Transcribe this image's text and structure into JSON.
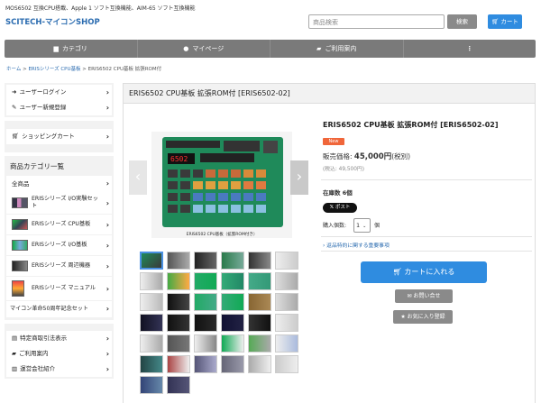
{
  "header": {
    "tagline": "MOS6502 互換CPU搭載、Apple 1 ソフト互換機能、AIM-65 ソフト互換機能",
    "shop_name": "SCITECH-マイコンSHOP",
    "search_placeholder": "商品検索",
    "search_button": "検索",
    "cart_button": "カート"
  },
  "nav": {
    "items": [
      {
        "label": "カテゴリ",
        "icon": "folder-icon"
      },
      {
        "label": "マイページ",
        "icon": "user-icon"
      },
      {
        "label": "ご利用案内",
        "icon": "map-icon"
      },
      {
        "label": "",
        "icon": "more-vertical-icon"
      }
    ]
  },
  "breadcrumb": {
    "home": "ホーム",
    "sep": ">",
    "category": "ERISシリーズ CPU基板",
    "current": "ERIS6502 CPU基板 拡張ROM付"
  },
  "sidebar": {
    "account": [
      {
        "label": "ユーザーログイン",
        "icon": "login-icon"
      },
      {
        "label": "ユーザー新規登録",
        "icon": "pencil-icon"
      }
    ],
    "cart_link": {
      "label": "ショッピングカート",
      "icon": "cart-icon"
    },
    "categories_title": "商品カテゴリ一覧",
    "categories": [
      {
        "label": "全商品"
      },
      {
        "label": "ERISシリーズ I/O実験セット"
      },
      {
        "label": "ERISシリーズ CPU基板"
      },
      {
        "label": "ERISシリーズ I/O基板"
      },
      {
        "label": "ERISシリーズ 周辺機器"
      },
      {
        "label": "ERISシリーズ マニュアル"
      },
      {
        "label": "マイコン革命50周年記念セット"
      }
    ],
    "info_links": [
      {
        "label": "特定商取引法表示",
        "icon": "document-icon"
      },
      {
        "label": "ご利用案内",
        "icon": "book-icon"
      },
      {
        "label": "運営会社紹介",
        "icon": "building-icon"
      }
    ]
  },
  "product": {
    "heading": "ERIS6502 CPU基板 拡張ROM付 [ERIS6502-02]",
    "title": "ERIS6502 CPU基板 拡張ROM付 [ERIS6502-02]",
    "badge": "New",
    "price_label": "販売価格:",
    "price_value": "45,000円",
    "price_tax": "(税別)",
    "price_taxin": "(税込: 49,500円)",
    "stock": "在庫数 6個",
    "x_post": "ポスト",
    "qty_label": "購入個数:",
    "qty_value": "1",
    "qty_unit": "個",
    "note_link": "返品特約に関する重要事項",
    "add_to_cart": "カートに入れる",
    "contact": "お問い合せ",
    "favorite": "お気に入り登録",
    "image_caption": "ERIS6502 CPU基板（拡張ROM付き）",
    "display_digits": "6502"
  },
  "colors": {
    "accent": "#2f8ce0",
    "nav_bg": "#7a7a7a",
    "badge": "#f0663a"
  }
}
